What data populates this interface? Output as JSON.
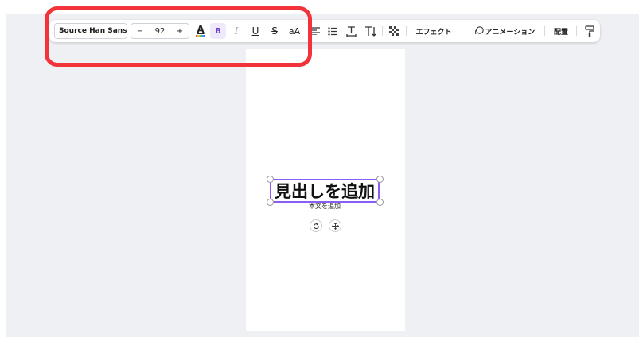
{
  "toolbar": {
    "font_name": "Source Han Sans ...",
    "size_minus": "−",
    "font_size": "92",
    "size_plus": "+",
    "text_color_label": "A",
    "bold_label": "B",
    "italic_label": "I",
    "underline_label": "U",
    "strike_label": "S",
    "case_label": "aA",
    "effects_label": "エフェクト",
    "animation_label": "アニメーション",
    "position_label": "配置"
  },
  "canvas": {
    "heading": "見出しを追加",
    "body": "本文を追加"
  },
  "colors": {
    "workspace": "#eff0f4",
    "selection": "#8b5cf6",
    "highlight": "#f2333a",
    "bold_active_bg": "#eee9fb"
  },
  "icons": [
    "text-color-icon",
    "align-icon",
    "list-icon",
    "letter-spacing-icon",
    "vertical-text-icon",
    "transparency-icon",
    "animation-icon",
    "paint-roller-icon",
    "rotate-icon",
    "move-icon"
  ]
}
